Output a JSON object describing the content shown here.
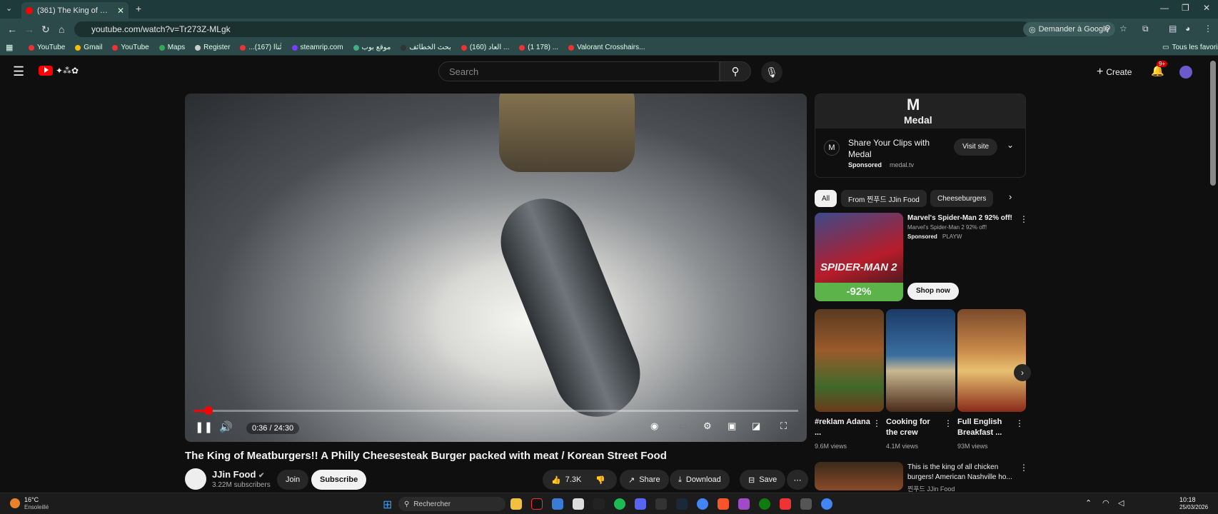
{
  "browser": {
    "tab_title": "(361) The King of Meatbur",
    "url": "youtube.com/watch?v=Tr273Z-MLgk",
    "demander_label": "Demander à Google",
    "bookmarks": [
      "YouTube",
      "Gmail",
      "YouTube",
      "Maps",
      "Register",
      "...‫ئ‬ٰ‫تا‬‫ا‬ (167)",
      "steamrip.com",
      "‫ﻣﻮﻗﻊ‬ ‫ﺑﻮﺏ‬",
      "‫ﺑﺤﺚ‬ ‫ﺍﻟﺨﻄﺎﺋﻒ‬",
      "(160) ‫ﺍﻟﻌﺎﺩ‬ ...",
      "(1 178) ...",
      "Valorant Crosshairs..."
    ],
    "all_bookmarks_label": "Tous les favoris"
  },
  "youtube": {
    "search_placeholder": "Search",
    "create_label": "Create",
    "notif_badge": "9+",
    "video": {
      "time": "0:36 / 24:30",
      "progress": 0.025,
      "title": "The King of Meatburgers!! A Philly Cheesesteak Burger packed with meat / Korean Street Food",
      "channel": "JJin Food",
      "subscribers": "3.22M subscribers",
      "join_label": "Join",
      "subscribe_label": "Subscribe",
      "likes": "7.3K",
      "share_label": "Share",
      "download_label": "Download",
      "save_label": "Save"
    },
    "ad": {
      "brand": "Medal",
      "headline": "Share Your Clips with Medal",
      "sponsored": "Sponsored",
      "domain": "medal.tv",
      "visit_label": "Visit site"
    },
    "chips": [
      "All",
      "From 찐푸드 JJin Food",
      "Cheeseburgers"
    ],
    "sponsored_game": {
      "title": "Marvel's Spider-Man 2 92% off!",
      "subtitle": "Marvel's Spider-Man 2 92% off!",
      "sponsored": "Sponsored",
      "advertiser": "PLAYW",
      "thumb_title": "SPIDER-MAN 2",
      "discount": "-92%",
      "cta": "Shop now"
    },
    "shorts": [
      {
        "title": "#reklam Adana ...",
        "views": "9.6M views"
      },
      {
        "title": "Cooking for the crew",
        "views": "4.1M views"
      },
      {
        "title": "Full English Breakfast ...",
        "views": "93M views"
      }
    ],
    "next_video": {
      "title": "This is the king of all chicken burgers! American Nashville ho...",
      "channel": "찐푸드 JJin Food"
    }
  },
  "taskbar": {
    "weather_temp": "16°C",
    "weather_desc": "Ensoleillé",
    "search_label": "Rechercher",
    "time": "10:18",
    "date": "25/03/2026"
  }
}
